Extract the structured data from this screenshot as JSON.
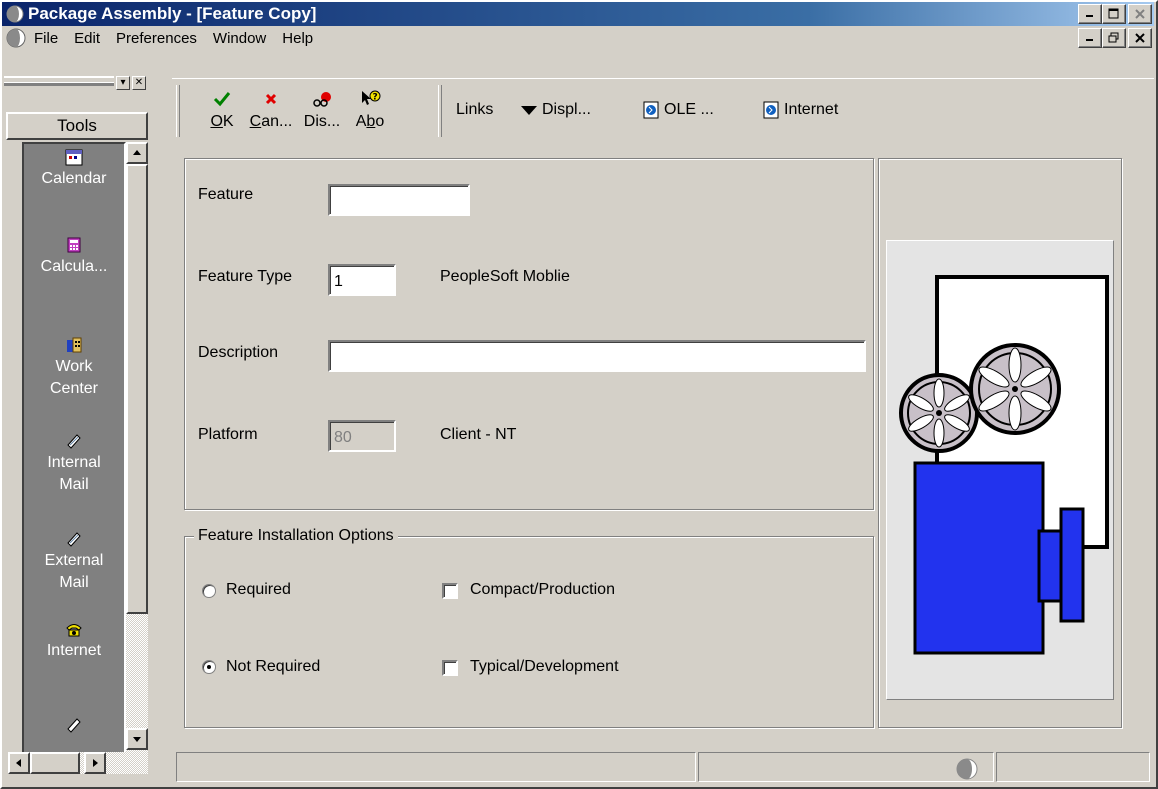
{
  "window": {
    "title": "Package Assembly - [Feature Copy]"
  },
  "menu": {
    "items": [
      "File",
      "Edit",
      "Preferences",
      "Window",
      "Help"
    ]
  },
  "tools": {
    "header": "Tools",
    "items": [
      {
        "label": "Calendar",
        "icon": "calendar-icon"
      },
      {
        "label": "Calcula...",
        "icon": "calculator-icon"
      },
      {
        "label": "Work Center",
        "icon": "work-center-icon"
      },
      {
        "label": "Internal Mail",
        "icon": "internal-mail-icon"
      },
      {
        "label": "External Mail",
        "icon": "external-mail-icon"
      },
      {
        "label": "Internet",
        "icon": "internet-phone-icon"
      }
    ]
  },
  "toolbar": {
    "ok_accel": "O",
    "ok_rest": "K",
    "cancel_accel": "C",
    "cancel_rest": "an...",
    "display_label": "Dis...",
    "about_pre": "A",
    "about_accel": "b",
    "about_rest": "o",
    "links_label": "Links",
    "display_link_label": "Displ...",
    "ole_label": "OLE ...",
    "internet_label": "Internet"
  },
  "form": {
    "feature_label": "Feature",
    "feature_value": "",
    "feature_type_label": "Feature Type",
    "feature_type_value": "1",
    "feature_type_desc": "PeopleSoft Moblie",
    "description_label": "Description",
    "description_value": "",
    "platform_label": "Platform",
    "platform_value": "80",
    "platform_desc": "Client - NT"
  },
  "options": {
    "group_label": "Feature Installation Options",
    "required_label": "Required",
    "not_required_label": "Not Required",
    "selected": "Not Required",
    "compact_label": "Compact/Production",
    "compact_checked": false,
    "typical_label": "Typical/Development",
    "typical_checked": false
  },
  "colors": {
    "title_bar": "#0a246a",
    "face": "#d4d0c8",
    "projector_body": "#2233ee",
    "reel": "#c8c0c8"
  }
}
